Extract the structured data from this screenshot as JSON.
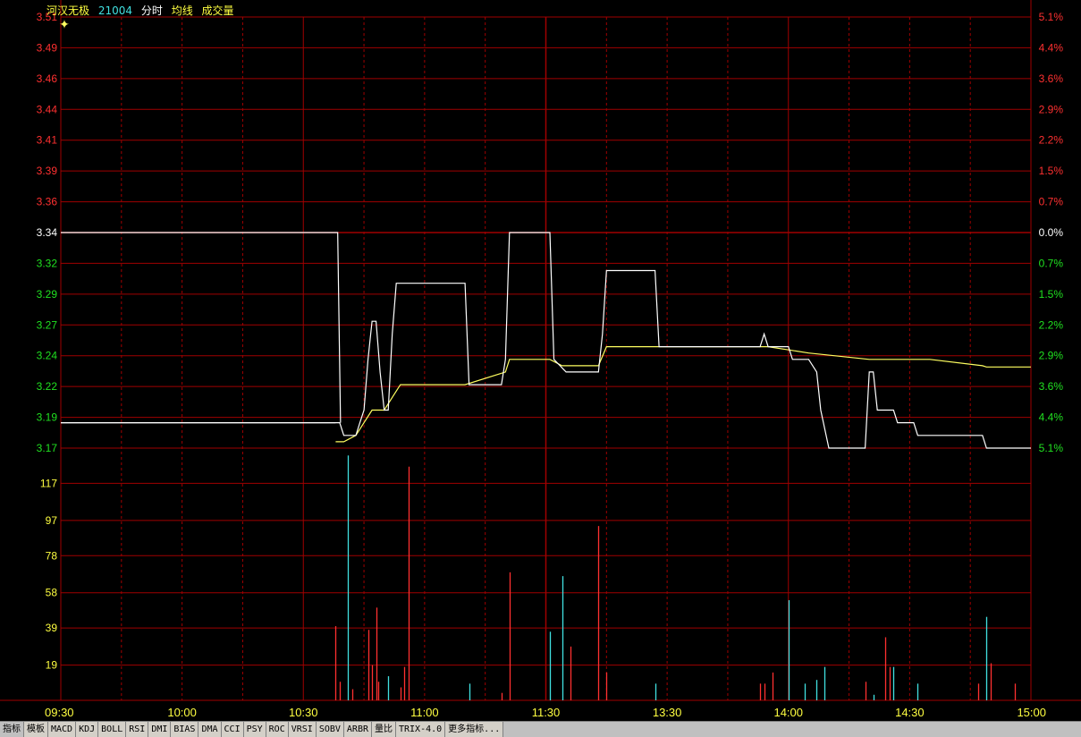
{
  "header": {
    "stock_name": "河汉无极",
    "stock_code": "21004",
    "labels": [
      "分时",
      "均线",
      "成交量"
    ]
  },
  "colors": {
    "grid": "#a00000",
    "axis_red": "#ff3030",
    "axis_green": "#20e020",
    "axis_white": "#ffffff",
    "axis_yellow": "#ffff40",
    "price_line": "#ffffff",
    "avg_line": "#ffff60",
    "vol_up": "#ff3030",
    "vol_down": "#40e0e0"
  },
  "chart_data": {
    "type": "line",
    "price_axis": {
      "labels": [
        "3.51",
        "3.49",
        "3.46",
        "3.44",
        "3.41",
        "3.39",
        "3.36",
        "3.34",
        "3.32",
        "3.29",
        "3.27",
        "3.24",
        "3.22",
        "3.19",
        "3.17"
      ],
      "reference": "3.34",
      "ylim": [
        3.17,
        3.51
      ]
    },
    "percent_axis": {
      "labels": [
        "5.1%",
        "4.4%",
        "3.6%",
        "2.9%",
        "2.2%",
        "1.5%",
        "0.7%",
        "0.0%",
        "0.7%",
        "1.5%",
        "2.2%",
        "2.9%",
        "3.6%",
        "4.4%",
        "5.1%"
      ]
    },
    "volume_axis": {
      "labels": [
        "117",
        "97",
        "78",
        "58",
        "39",
        "19"
      ],
      "ylim": [
        0,
        136
      ]
    },
    "time_axis": {
      "labels": [
        "09:30",
        "10:00",
        "10:30",
        "11:00",
        "11:30",
        "13:30",
        "14:00",
        "14:30",
        "15:00"
      ],
      "total_minutes": 240
    },
    "price_series": [
      [
        0,
        3.19
      ],
      [
        68,
        3.19
      ],
      [
        69,
        3.34
      ],
      [
        68,
        3.34
      ],
      [
        68,
        3.34
      ],
      [
        0,
        3.19
      ],
      [
        69,
        3.19
      ],
      [
        70,
        3.18
      ],
      [
        71,
        3.18
      ],
      [
        73,
        3.18
      ],
      [
        74,
        3.19
      ],
      [
        75,
        3.2
      ],
      [
        76,
        3.24
      ],
      [
        77,
        3.27
      ],
      [
        78,
        3.27
      ],
      [
        79,
        3.23
      ],
      [
        80,
        3.2
      ],
      [
        81,
        3.2
      ],
      [
        82,
        3.26
      ],
      [
        83,
        3.3
      ],
      [
        84,
        3.3
      ],
      [
        100,
        3.3
      ],
      [
        101,
        3.22
      ],
      [
        109,
        3.22
      ],
      [
        110,
        3.24
      ],
      [
        111,
        3.34
      ],
      [
        121,
        3.34
      ],
      [
        122,
        3.24
      ],
      [
        125,
        3.23
      ],
      [
        133,
        3.23
      ],
      [
        134,
        3.26
      ],
      [
        135,
        3.31
      ],
      [
        147,
        3.31
      ],
      [
        148,
        3.25
      ],
      [
        173,
        3.25
      ],
      [
        174,
        3.26
      ],
      [
        175,
        3.25
      ],
      [
        180,
        3.25
      ],
      [
        181,
        3.24
      ],
      [
        185,
        3.24
      ],
      [
        187,
        3.23
      ],
      [
        188,
        3.2
      ],
      [
        190,
        3.17
      ],
      [
        199,
        3.17
      ],
      [
        200,
        3.23
      ],
      [
        201,
        3.23
      ],
      [
        202,
        3.2
      ],
      [
        206,
        3.2
      ],
      [
        207,
        3.19
      ],
      [
        211,
        3.19
      ],
      [
        212,
        3.18
      ],
      [
        228,
        3.18
      ],
      [
        229,
        3.17
      ],
      [
        240,
        3.17
      ]
    ],
    "avg_series": [
      [
        68,
        3.175
      ],
      [
        70,
        3.175
      ],
      [
        73,
        3.18
      ],
      [
        75,
        3.19
      ],
      [
        77,
        3.2
      ],
      [
        80,
        3.2
      ],
      [
        82,
        3.21
      ],
      [
        84,
        3.22
      ],
      [
        100,
        3.22
      ],
      [
        110,
        3.23
      ],
      [
        111,
        3.24
      ],
      [
        121,
        3.24
      ],
      [
        124,
        3.235
      ],
      [
        133,
        3.235
      ],
      [
        135,
        3.25
      ],
      [
        145,
        3.25
      ],
      [
        175,
        3.25
      ],
      [
        185,
        3.245
      ],
      [
        200,
        3.24
      ],
      [
        215,
        3.24
      ],
      [
        228,
        3.235
      ],
      [
        229,
        3.234
      ],
      [
        240,
        3.234
      ]
    ],
    "volume_bars": [
      [
        68,
        40,
        "up"
      ],
      [
        69,
        10,
        "up"
      ],
      [
        71,
        132,
        "down"
      ],
      [
        72,
        6,
        "up"
      ],
      [
        76,
        38,
        "up"
      ],
      [
        77,
        19,
        "up"
      ],
      [
        78,
        50,
        "up"
      ],
      [
        78.6,
        10,
        "up"
      ],
      [
        81,
        13,
        "down"
      ],
      [
        84,
        7,
        "up"
      ],
      [
        85,
        18,
        "up"
      ],
      [
        86,
        126,
        "up"
      ],
      [
        101,
        9,
        "down"
      ],
      [
        109,
        4,
        "up"
      ],
      [
        111,
        69,
        "up"
      ],
      [
        121,
        37,
        "down"
      ],
      [
        124,
        67,
        "down"
      ],
      [
        126,
        29,
        "up"
      ],
      [
        133,
        94,
        "up"
      ],
      [
        135,
        15,
        "up"
      ],
      [
        147,
        9,
        "down"
      ],
      [
        173,
        9,
        "up"
      ],
      [
        174,
        9,
        "up"
      ],
      [
        176,
        15,
        "up"
      ],
      [
        180,
        54,
        "down"
      ],
      [
        184,
        9,
        "down"
      ],
      [
        187,
        11,
        "down"
      ],
      [
        189,
        18,
        "down"
      ],
      [
        199,
        10,
        "up"
      ],
      [
        201,
        3,
        "down"
      ],
      [
        204,
        34,
        "up"
      ],
      [
        205,
        18,
        "up"
      ],
      [
        206,
        18,
        "down"
      ],
      [
        212,
        9,
        "down"
      ],
      [
        227,
        9,
        "up"
      ],
      [
        229,
        45,
        "down"
      ],
      [
        230,
        20,
        "up"
      ],
      [
        236,
        9,
        "up"
      ]
    ]
  },
  "toolbar": {
    "tabs": [
      "指标",
      "模板",
      "MACD",
      "KDJ",
      "BOLL",
      "RSI",
      "DMI",
      "BIAS",
      "DMA",
      "CCI",
      "PSY",
      "ROC",
      "VRSI",
      "SOBV",
      "ARBR",
      "量比",
      "TRIX-4.0",
      "更多指标..."
    ]
  }
}
